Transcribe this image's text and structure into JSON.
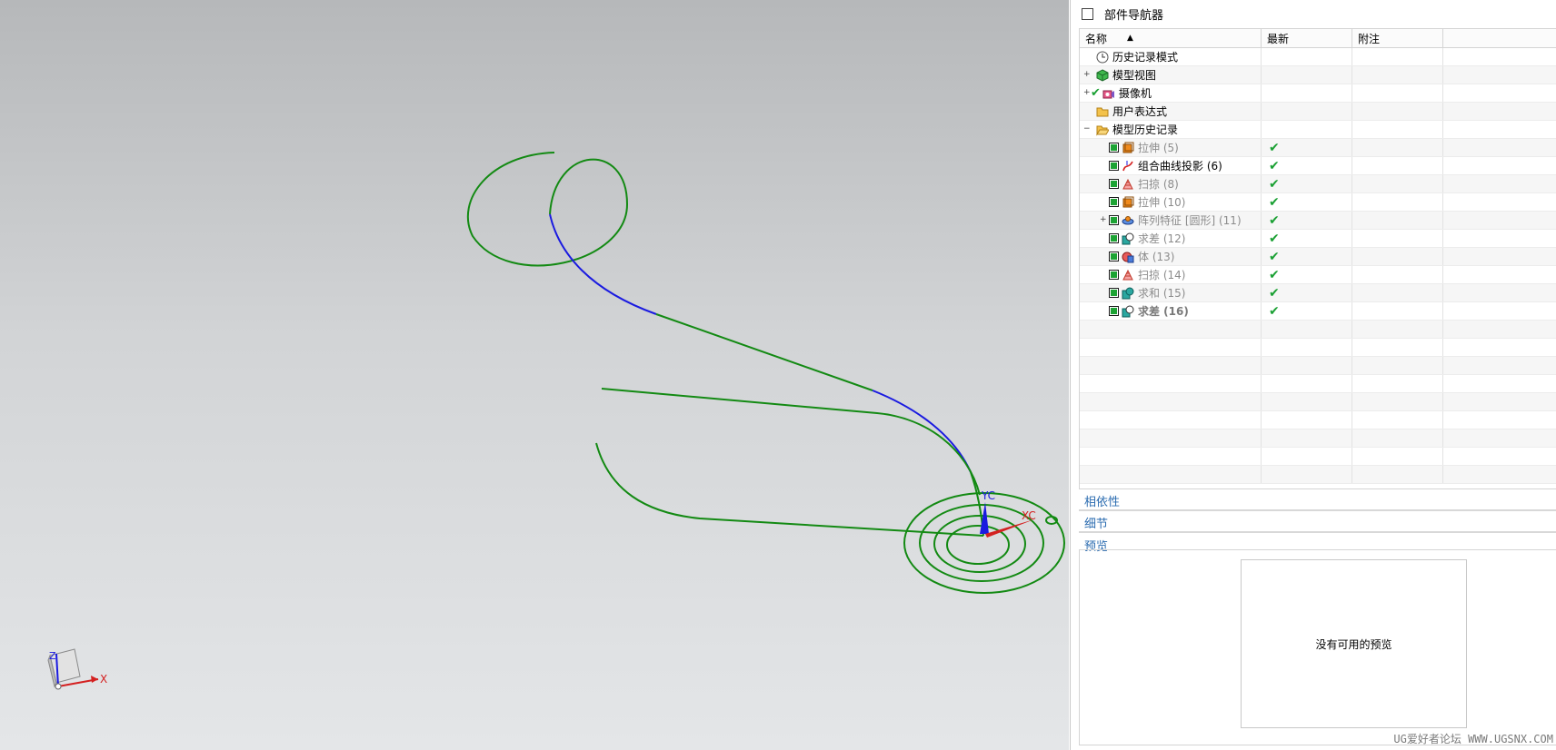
{
  "navigator": {
    "title": "部件导航器",
    "columns": {
      "name": "名称",
      "latest": "最新",
      "note": "附注"
    },
    "items": [
      {
        "label": "历史记录模式",
        "icon": "clock-icon",
        "indent": 0,
        "expander": "",
        "checkbox": false,
        "latest": "",
        "style": "norm"
      },
      {
        "label": "模型视图",
        "icon": "model-view-icon",
        "indent": 0,
        "expander": "+",
        "checkbox": false,
        "latest": "",
        "style": "norm"
      },
      {
        "label": "摄像机",
        "icon": "camera-icon",
        "indent": 0,
        "expander": "+",
        "checkbox": false,
        "checkmark": true,
        "latest": "",
        "style": "norm"
      },
      {
        "label": "用户表达式",
        "icon": "folder-icon",
        "indent": 0,
        "expander": "",
        "checkbox": false,
        "latest": "",
        "style": "norm"
      },
      {
        "label": "模型历史记录",
        "icon": "folder-open-icon",
        "indent": 0,
        "expander": "−",
        "checkbox": false,
        "latest": "",
        "style": "norm"
      },
      {
        "label": "拉伸 (5)",
        "icon": "extrude-icon",
        "indent": 1,
        "expander": "",
        "checkbox": true,
        "latest": "✔",
        "style": "dim"
      },
      {
        "label": "组合曲线投影 (6)",
        "icon": "curve-projection-icon",
        "indent": 1,
        "expander": "",
        "checkbox": true,
        "latest": "✔",
        "style": "norm"
      },
      {
        "label": "扫掠 (8)",
        "icon": "sweep-icon",
        "indent": 1,
        "expander": "",
        "checkbox": true,
        "latest": "✔",
        "style": "dim"
      },
      {
        "label": "拉伸 (10)",
        "icon": "extrude-icon",
        "indent": 1,
        "expander": "",
        "checkbox": true,
        "latest": "✔",
        "style": "dim"
      },
      {
        "label": "阵列特征 [圆形] (11)",
        "icon": "pattern-icon",
        "indent": 1,
        "expander": "+",
        "checkbox": true,
        "latest": "✔",
        "style": "dim"
      },
      {
        "label": "求差 (12)",
        "icon": "subtract-icon",
        "indent": 1,
        "expander": "",
        "checkbox": true,
        "latest": "✔",
        "style": "dim"
      },
      {
        "label": "体 (13)",
        "icon": "body-icon",
        "indent": 1,
        "expander": "",
        "checkbox": true,
        "latest": "✔",
        "style": "dim"
      },
      {
        "label": "扫掠 (14)",
        "icon": "sweep-icon",
        "indent": 1,
        "expander": "",
        "checkbox": true,
        "latest": "✔",
        "style": "dim"
      },
      {
        "label": "求和 (15)",
        "icon": "unite-icon",
        "indent": 1,
        "expander": "",
        "checkbox": true,
        "latest": "✔",
        "style": "dim"
      },
      {
        "label": "求差 (16)",
        "icon": "subtract-icon",
        "indent": 1,
        "expander": "",
        "checkbox": true,
        "latest": "✔",
        "style": "bold-last"
      }
    ],
    "empty_rows": 9
  },
  "panels": {
    "dependencies": "相依性",
    "details": "细节",
    "preview": "预览",
    "preview_empty": "没有可用的预览"
  },
  "viewport": {
    "triad_x": "X",
    "triad_z": "Z",
    "csys_xc": "XC",
    "csys_yc": "YC",
    "curve_color": "#138a13",
    "highlight_color": "#1a1ae0"
  },
  "watermark": "UG爱好者论坛 WWW.UGSNX.COM"
}
